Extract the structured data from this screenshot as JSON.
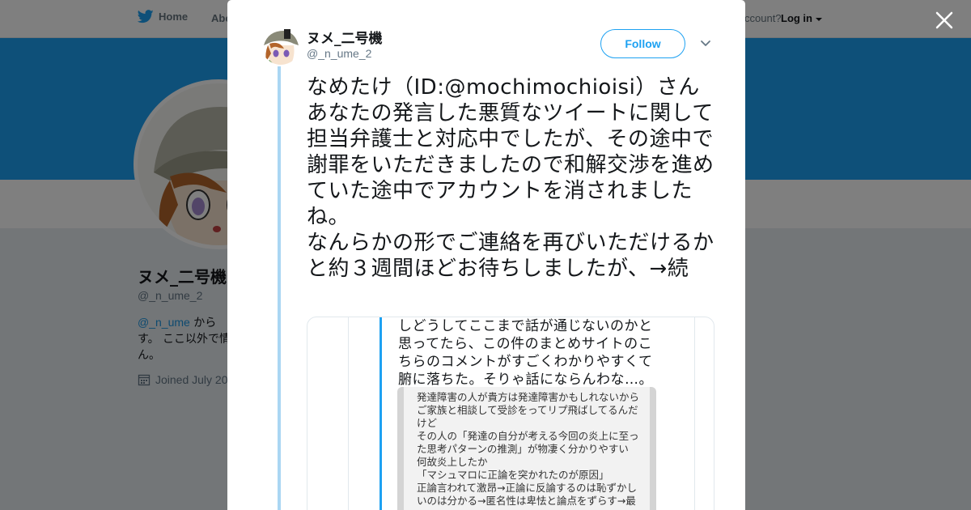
{
  "nav": {
    "home": "Home",
    "about": "Abo",
    "account_prompt": "ccount?",
    "login": "Log in"
  },
  "profile": {
    "name": "ヌメ_二号機",
    "handle": "@_n_ume_2",
    "bio_mention": "@_n_ume",
    "bio_rest": "から",
    "bio_line2": "す。 ここ以外で情",
    "bio_line3": "ん。",
    "joined": "Joined July 20"
  },
  "tweet": {
    "author_name": "ヌメ_二号機",
    "author_handle": "@_n_ume_2",
    "follow_label": "Follow",
    "text": "なめたけ（ID:@mochimochioisi）さん\nあなたの発言した悪質なツイートに関して担当弁護士と対応中でしたが、その途中で謝罪をいただきましたので和解交渉を進めていた途中でアカウントを消されましたね。\nなんらかの形でご連絡を再びいただけるかと約３週間ほどお待ちしましたが、→続",
    "media_text": "しどうしてここまで話が通じないのかと思ってたら、この件のまとめサイトのこちらのコメントがすごくわかりやすくて腑に落ちた。そりゃ話にならんわな…。",
    "media_shot_lines": [
      "発達障害の人が貴方は発達障害かもしれないから",
      "ご家族と相談して受診をってリプ飛ばしてるんだ",
      "けど",
      "その人の「発達の自分が考える今回の炎上に至っ",
      "た思考パターンの推測」が物凄く分かりやすい",
      "何故炎上したか",
      "「マシュマロに正論を突かれたのが原因」",
      "正論言われて激昂→正論に反論するのは恥ずかし",
      "いのは分かる→匿名性は卑怯と論点をずらす→最"
    ]
  },
  "colors": {
    "brand": "#1da1f2",
    "overlay": "rgba(0,0,0,0.5)"
  }
}
